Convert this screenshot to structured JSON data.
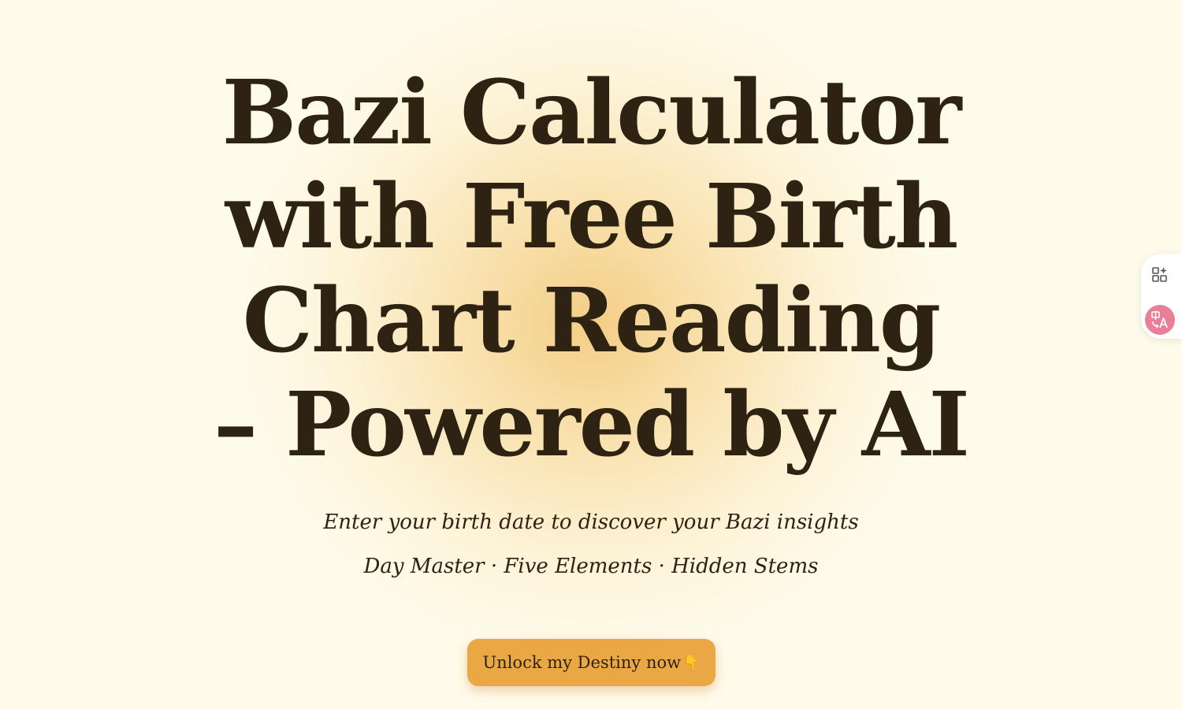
{
  "hero": {
    "title_lines": [
      "Bazi Calculator",
      "with Free Birth",
      "Chart Reading",
      "– Powered by AI"
    ]
  },
  "tagline": {
    "line1": "Enter your birth date to discover your Bazi insights",
    "line2": "Day Master · Five Elements · Hidden Stems"
  },
  "cta": {
    "label": "Unlock my Destiny now",
    "emoji": "👇"
  },
  "side_widget": {
    "apps_icon": "apps-sparkle-icon",
    "translate_icon": "translate-icon",
    "translate_color": "#e87f96"
  },
  "colors": {
    "background": "#fefbeb",
    "text": "#2e2213",
    "accent": "#e9a843"
  }
}
